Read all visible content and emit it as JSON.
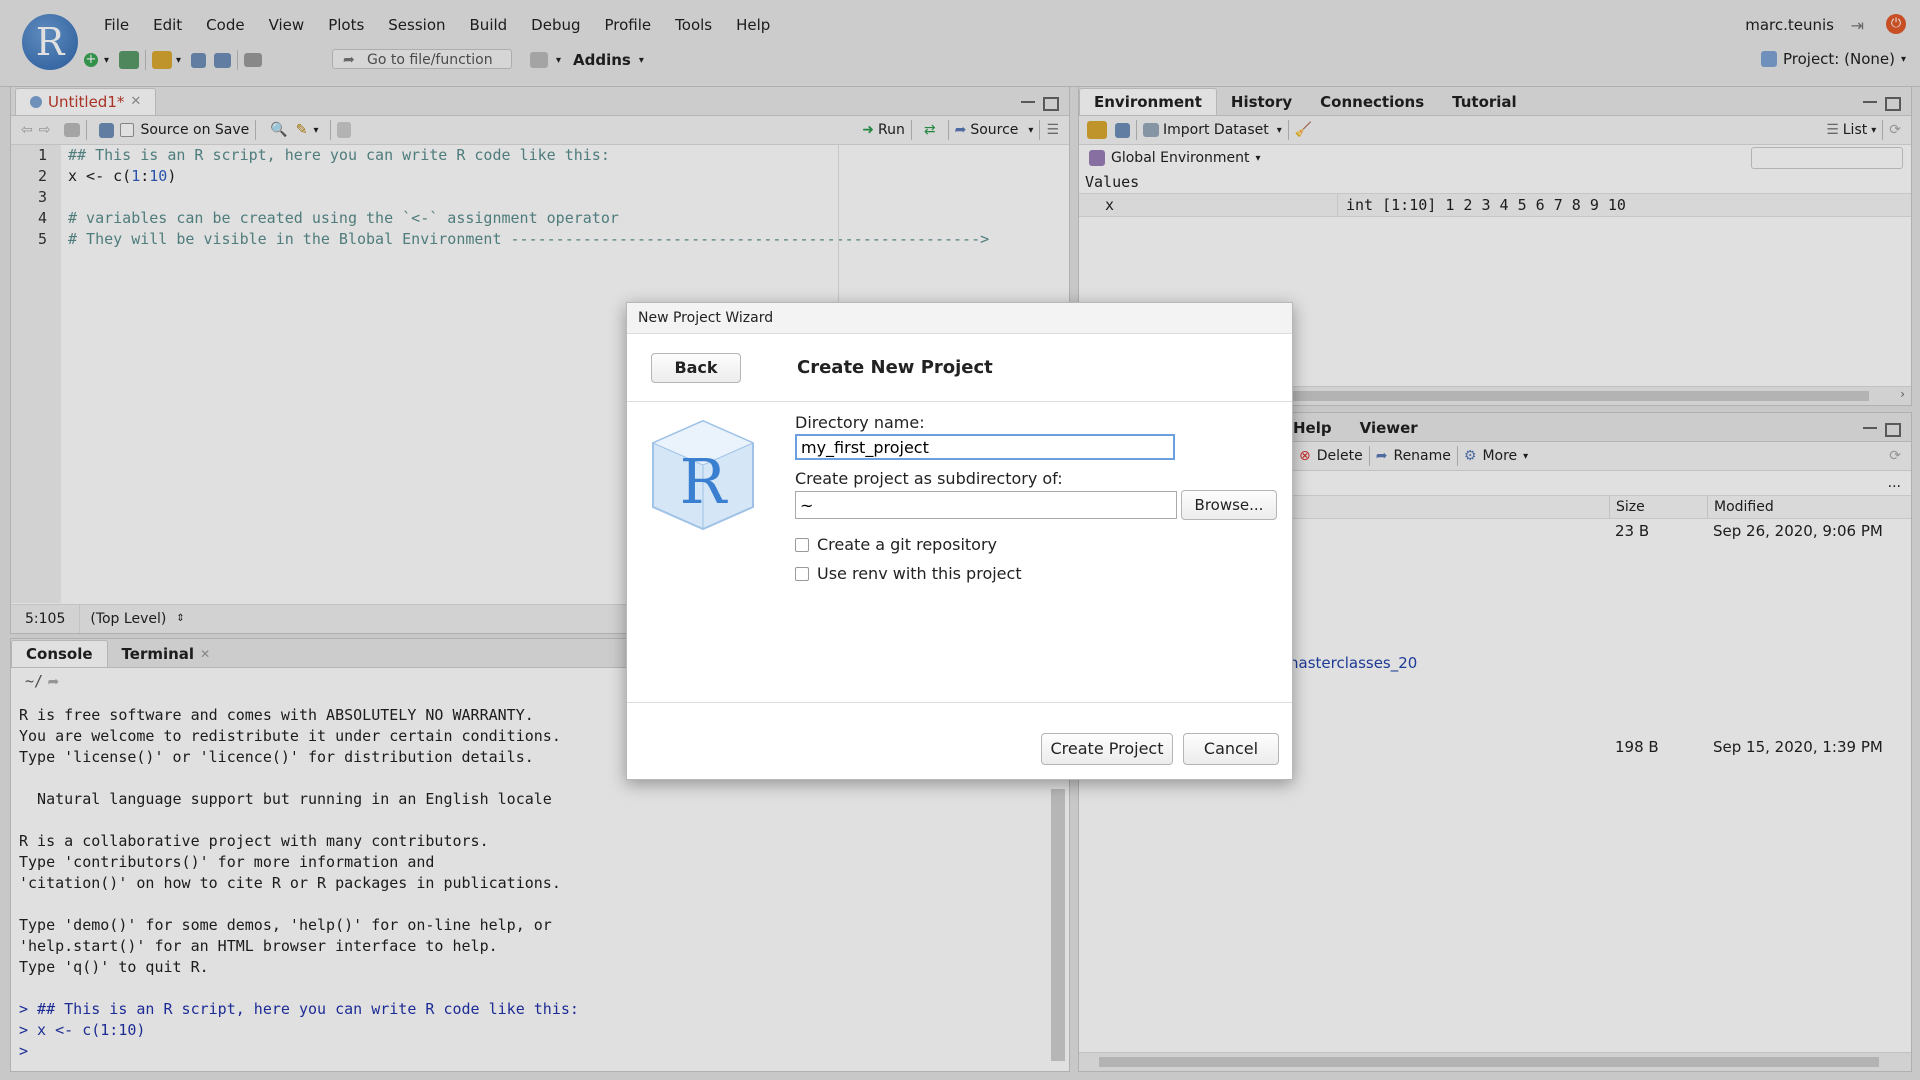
{
  "menu": [
    "File",
    "Edit",
    "Code",
    "View",
    "Plots",
    "Session",
    "Build",
    "Debug",
    "Profile",
    "Tools",
    "Help"
  ],
  "user": "marc.teunis",
  "toolbar": {
    "goto": "Go to file/function",
    "addins": "Addins",
    "project": "Project: (None)"
  },
  "editor": {
    "tab": "Untitled1*",
    "source_on_save": "Source on Save",
    "run": "Run",
    "source": "Source",
    "lines": [
      {
        "n": "1",
        "text": "## This is an R script, here you can write R code like this:"
      },
      {
        "n": "2",
        "text": "x <- c(1:10)"
      },
      {
        "n": "3",
        "text": ""
      },
      {
        "n": "4",
        "text": "# variables can be created using the `<-` assignment operator"
      },
      {
        "n": "5",
        "text": "# They will be visible in the Blobal Environment ---------------------------------------------------->"
      }
    ],
    "status_pos": "5:105",
    "status_scope": "(Top Level)"
  },
  "console": {
    "tabs": [
      "Console",
      "Terminal"
    ],
    "path": "~/",
    "lines": [
      "R is free software and comes with ABSOLUTELY NO WARRANTY.",
      "You are welcome to redistribute it under certain conditions.",
      "Type 'license()' or 'licence()' for distribution details.",
      "",
      "  Natural language support but running in an English locale",
      "",
      "R is a collaborative project with many contributors.",
      "Type 'contributors()' for more information and",
      "'citation()' on how to cite R or R packages in publications.",
      "",
      "Type 'demo()' for some demos, 'help()' for on-line help, or",
      "'help.start()' for an HTML browser interface to help.",
      "Type 'q()' to quit R.",
      ""
    ],
    "input_lines": [
      "> ## This is an R script, here you can write R code like this:",
      "> x <- c(1:10)",
      "> "
    ]
  },
  "environment": {
    "tabs": [
      "Environment",
      "History",
      "Connections",
      "Tutorial"
    ],
    "import": "Import Dataset",
    "list": "List",
    "scope": "Global Environment",
    "section": "Values",
    "var_name": "x",
    "var_value": "int [1:10] 1 2 3 4 5 6 7 8 9 10"
  },
  "files": {
    "tabs": [
      "Help",
      "Viewer"
    ],
    "delete": "Delete",
    "rename": "Rename",
    "more": "More",
    "ellipsis": "...",
    "col_size": "Size",
    "col_modified": "Modified",
    "rows": [
      {
        "size": "23 B",
        "modified": "Sep 26, 2020, 9:06 PM"
      },
      {
        "name": "nasterclasses_20"
      },
      {
        "size": "198 B",
        "modified": "Sep 15, 2020, 1:39 PM"
      }
    ]
  },
  "dialog": {
    "title": "New Project Wizard",
    "back": "Back",
    "heading": "Create New Project",
    "dir_label": "Directory name:",
    "dir_value": "my_first_project",
    "sub_label": "Create project as subdirectory of:",
    "sub_value": "~",
    "browse": "Browse...",
    "git": "Create a git repository",
    "renv": "Use renv with this project",
    "create": "Create Project",
    "cancel": "Cancel"
  }
}
